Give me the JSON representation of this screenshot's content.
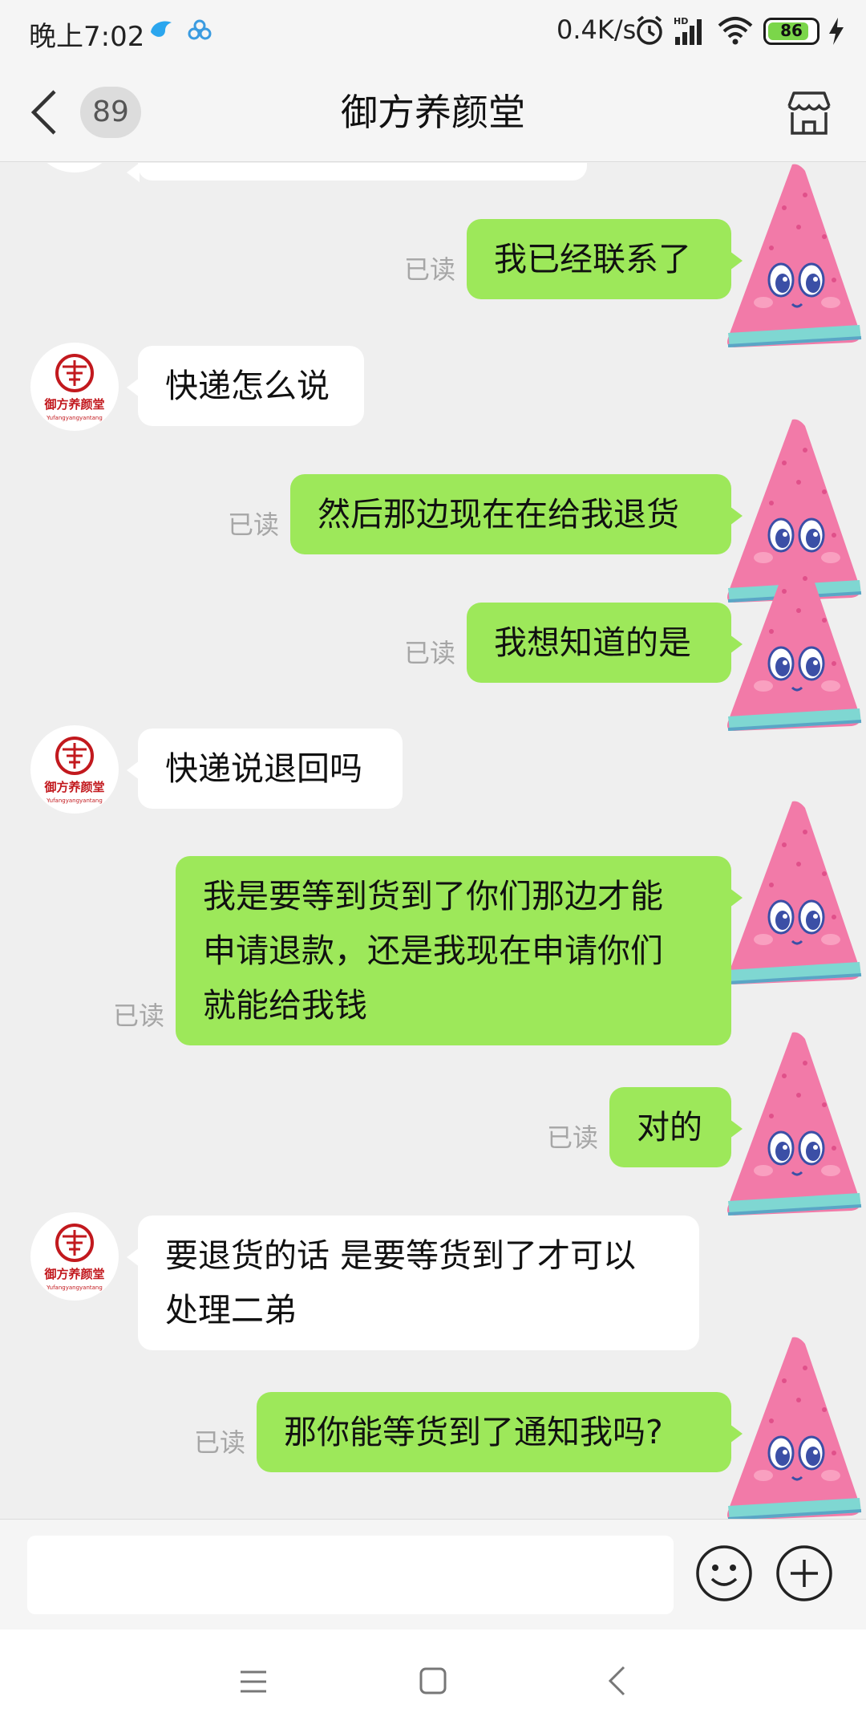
{
  "status_bar": {
    "time": "晚上7:02",
    "network_speed": "0.4K/s",
    "battery": "86",
    "icons": [
      "bird-icon",
      "cloud-icon",
      "alarm-icon",
      "hd-signal-icon",
      "wifi-icon",
      "battery-icon",
      "charging-icon"
    ]
  },
  "header": {
    "back_icon": "chevron-left-icon",
    "unread_count": "89",
    "title": "御方养颜堂",
    "shop_icon": "shop-icon"
  },
  "chat": {
    "read_label": "已读",
    "messages": [
      {
        "side": "out",
        "text": "我已经联系了",
        "read": "已读"
      },
      {
        "side": "in",
        "text": "快递怎么说"
      },
      {
        "side": "out",
        "text": "然后那边现在在给我退货",
        "read": "已读"
      },
      {
        "side": "out",
        "text": "我想知道的是",
        "read": "已读"
      },
      {
        "side": "in",
        "text": "快递说退回吗"
      },
      {
        "side": "out",
        "text": "我是要等到货到了你们那边才能\n申请退款，还是我现在申请你们\n就能给我钱",
        "read": "已读"
      },
      {
        "side": "out",
        "text": "对的",
        "read": "已读"
      },
      {
        "side": "in",
        "text": "要退货的话 是要等货到了才可以\n处理二弟"
      },
      {
        "side": "out",
        "text": "那你能等货到了通知我吗?",
        "read": "已读"
      }
    ],
    "shop_avatar_text": "御方养颜堂",
    "shop_avatar_subtext": "Yufangyangyantang"
  },
  "input_bar": {
    "placeholder": "",
    "emoji_icon": "smiley-icon",
    "plus_icon": "plus-circle-icon"
  },
  "nav_bar": {
    "icons": [
      "menu-icon",
      "home-square-icon",
      "back-triangle-icon"
    ]
  },
  "colors": {
    "bubble_out": "#9de85a",
    "bubble_in": "#ffffff",
    "background": "#efefef",
    "watermelon_pink": "#f27aa8",
    "watermelon_rind": "#7fd7d2"
  }
}
